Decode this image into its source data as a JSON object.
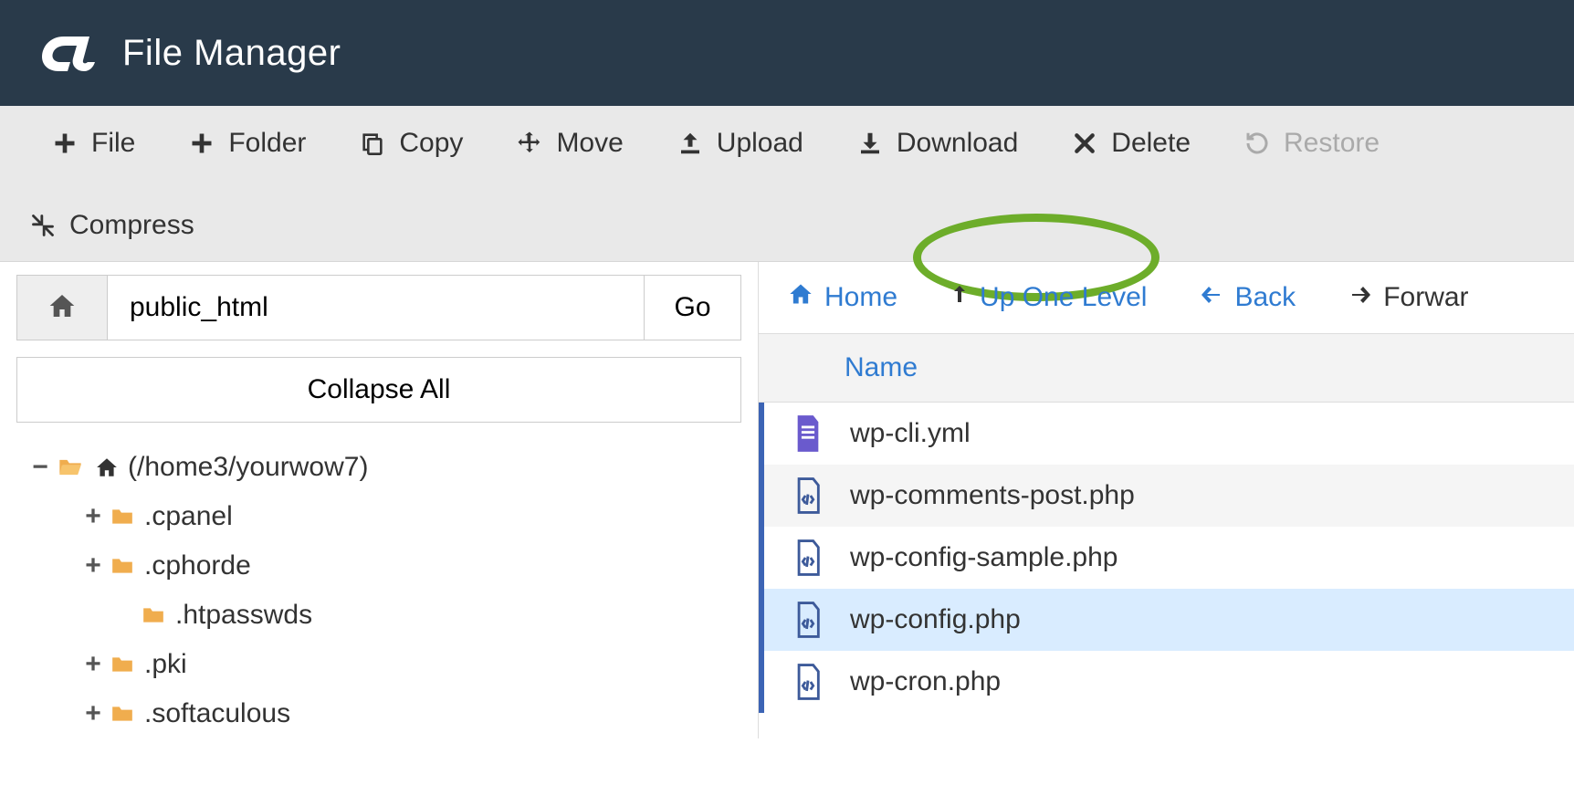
{
  "header": {
    "title": "File Manager"
  },
  "toolbar": {
    "file": "File",
    "folder": "Folder",
    "copy": "Copy",
    "move": "Move",
    "upload": "Upload",
    "download": "Download",
    "delete": "Delete",
    "restore": "Restore",
    "compress": "Compress"
  },
  "sidebar": {
    "path_value": "public_html",
    "go_label": "Go",
    "collapse_label": "Collapse All",
    "tree": {
      "root_label": "(/home3/yourwow7)",
      "items": [
        {
          "label": ".cpanel",
          "expandable": true
        },
        {
          "label": ".cphorde",
          "expandable": true
        },
        {
          "label": ".htpasswds",
          "expandable": false,
          "indent": true
        },
        {
          "label": ".pki",
          "expandable": true
        },
        {
          "label": ".softaculous",
          "expandable": true
        }
      ]
    }
  },
  "filepane": {
    "nav": {
      "home": "Home",
      "up": "Up One Level",
      "back": "Back",
      "forward": "Forwar"
    },
    "column_name": "Name",
    "files": [
      {
        "name": "wp-cli.yml",
        "type": "doc"
      },
      {
        "name": "wp-comments-post.php",
        "type": "code"
      },
      {
        "name": "wp-config-sample.php",
        "type": "code"
      },
      {
        "name": "wp-config.php",
        "type": "code",
        "selected": true
      },
      {
        "name": "wp-cron.php",
        "type": "code"
      }
    ]
  }
}
